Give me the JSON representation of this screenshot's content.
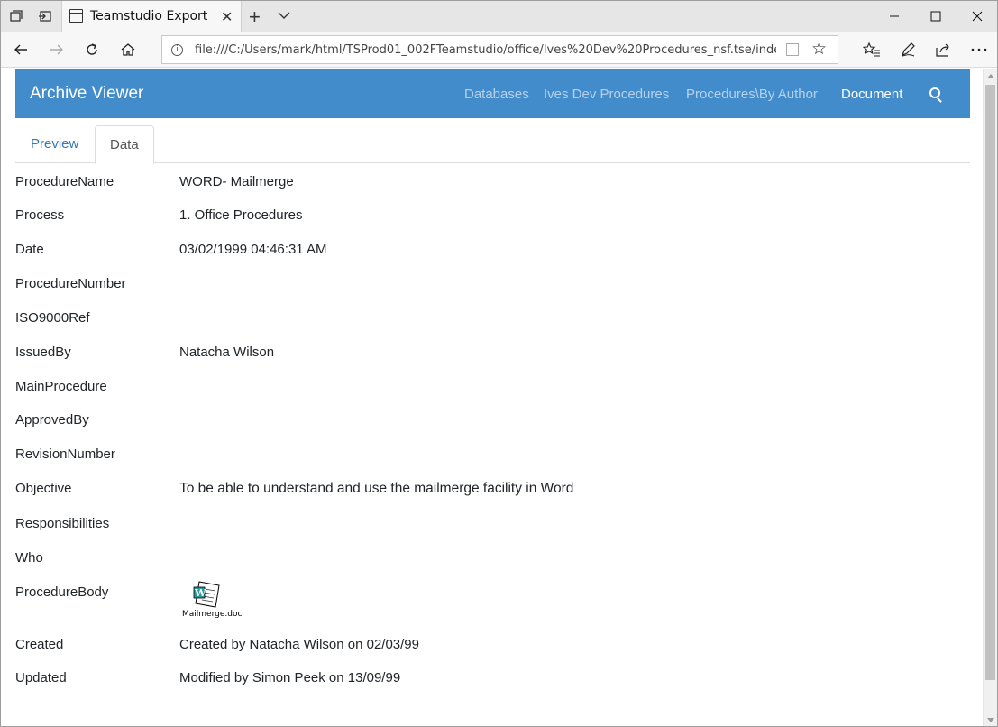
{
  "browser": {
    "tab_title": "Teamstudio Export",
    "url": "file:///C:/Users/mark/html/TSProd01_002FTeamstudio/office/Ives%20Dev%20Procedures_nsf.tse/index.html#/dbs"
  },
  "app": {
    "brand": "Archive Viewer",
    "accent_color": "#438ccb",
    "nav": [
      {
        "label": "Databases",
        "active": false
      },
      {
        "label": "Ives Dev Procedures",
        "active": false
      },
      {
        "label": "Procedures\\By Author",
        "active": false
      },
      {
        "label": "Document",
        "active": true
      }
    ]
  },
  "tabs": [
    {
      "label": "Preview",
      "selected": false
    },
    {
      "label": "Data",
      "selected": true
    }
  ],
  "fields": [
    {
      "label": "ProcedureName",
      "value": "WORD- Mailmerge"
    },
    {
      "label": "Process",
      "value": "1. Office Procedures"
    },
    {
      "label": "Date",
      "value": "03/02/1999 04:46:31 AM"
    },
    {
      "label": "ProcedureNumber",
      "value": ""
    },
    {
      "label": "ISO9000Ref",
      "value": ""
    },
    {
      "label": "IssuedBy",
      "value": "Natacha Wilson"
    },
    {
      "label": "MainProcedure",
      "value": ""
    },
    {
      "label": "ApprovedBy",
      "value": ""
    },
    {
      "label": "RevisionNumber",
      "value": ""
    },
    {
      "label": "Objective",
      "value": "To be able to understand and use the mailmerge facility in Word"
    },
    {
      "label": "Responsibilities",
      "value": ""
    },
    {
      "label": "Who",
      "value": ""
    },
    {
      "label": "ProcedureBody",
      "value": ""
    },
    {
      "label": "Created",
      "value": "Created by Natacha Wilson on 02/03/99"
    },
    {
      "label": "Updated",
      "value": "Modified by Simon Peek on 13/09/99"
    }
  ],
  "attachment": {
    "file_name": "Mailmerge.doc",
    "icon": "word-document-icon"
  }
}
